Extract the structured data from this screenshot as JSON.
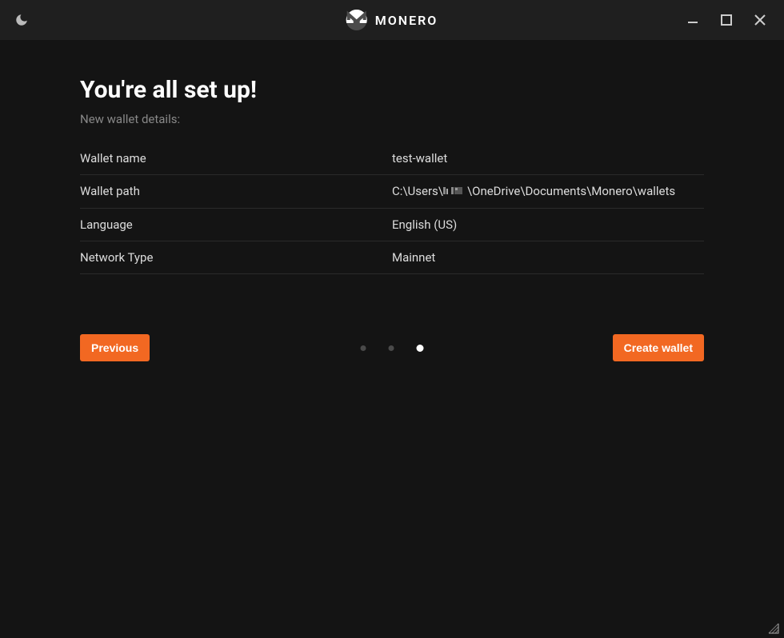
{
  "app": {
    "title": "MONERO"
  },
  "page": {
    "heading": "You're all set up!",
    "subheading": "New wallet details:"
  },
  "details": {
    "rows": [
      {
        "label": "Wallet name",
        "value": "test-wallet"
      },
      {
        "label": "Wallet path",
        "value_prefix": "C:\\Users\\",
        "value_suffix": "\\OneDrive\\Documents\\Monero\\wallets"
      },
      {
        "label": "Language",
        "value": "English (US)"
      },
      {
        "label": "Network Type",
        "value": "Mainnet"
      }
    ]
  },
  "buttons": {
    "previous": "Previous",
    "create": "Create wallet"
  },
  "stepper": {
    "total": 3,
    "active_index": 2
  },
  "colors": {
    "accent": "#f26822",
    "background": "#141414",
    "titlebar": "#1f1f1f"
  }
}
